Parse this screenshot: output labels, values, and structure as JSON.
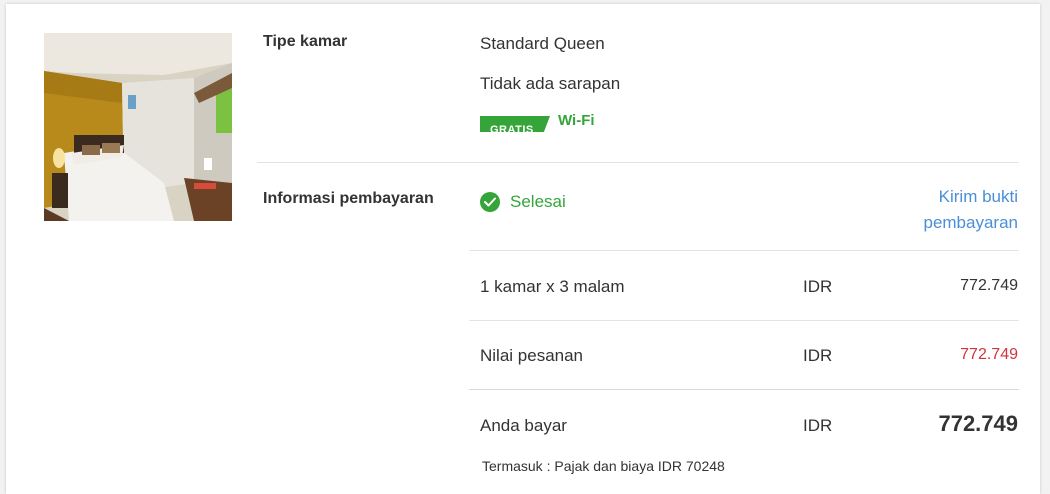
{
  "room_section": {
    "label": "Tipe kamar",
    "room_name": "Standard Queen",
    "breakfast": "Tidak ada sarapan",
    "wifi_badge": {
      "free_label": "GRATIS",
      "amenity_label": "Wi-Fi"
    }
  },
  "payment_section": {
    "label": "Informasi pembayaran",
    "status": "Selesai",
    "send_proof_link": "Kirim bukti pembayaran",
    "rows": [
      {
        "label": "1 kamar x 3 malam",
        "currency": "IDR",
        "amount": "772.749"
      },
      {
        "label": "Nilai pesanan",
        "currency": "IDR",
        "amount": "772.749"
      },
      {
        "label": "Anda bayar",
        "currency": "IDR",
        "amount": "772.749"
      }
    ],
    "includes_note": "Termasuk : Pajak dan biaya IDR 70248"
  },
  "colors": {
    "success_green": "#35a53a",
    "link_blue": "#4a8fd8",
    "price_red": "#d0343a"
  }
}
